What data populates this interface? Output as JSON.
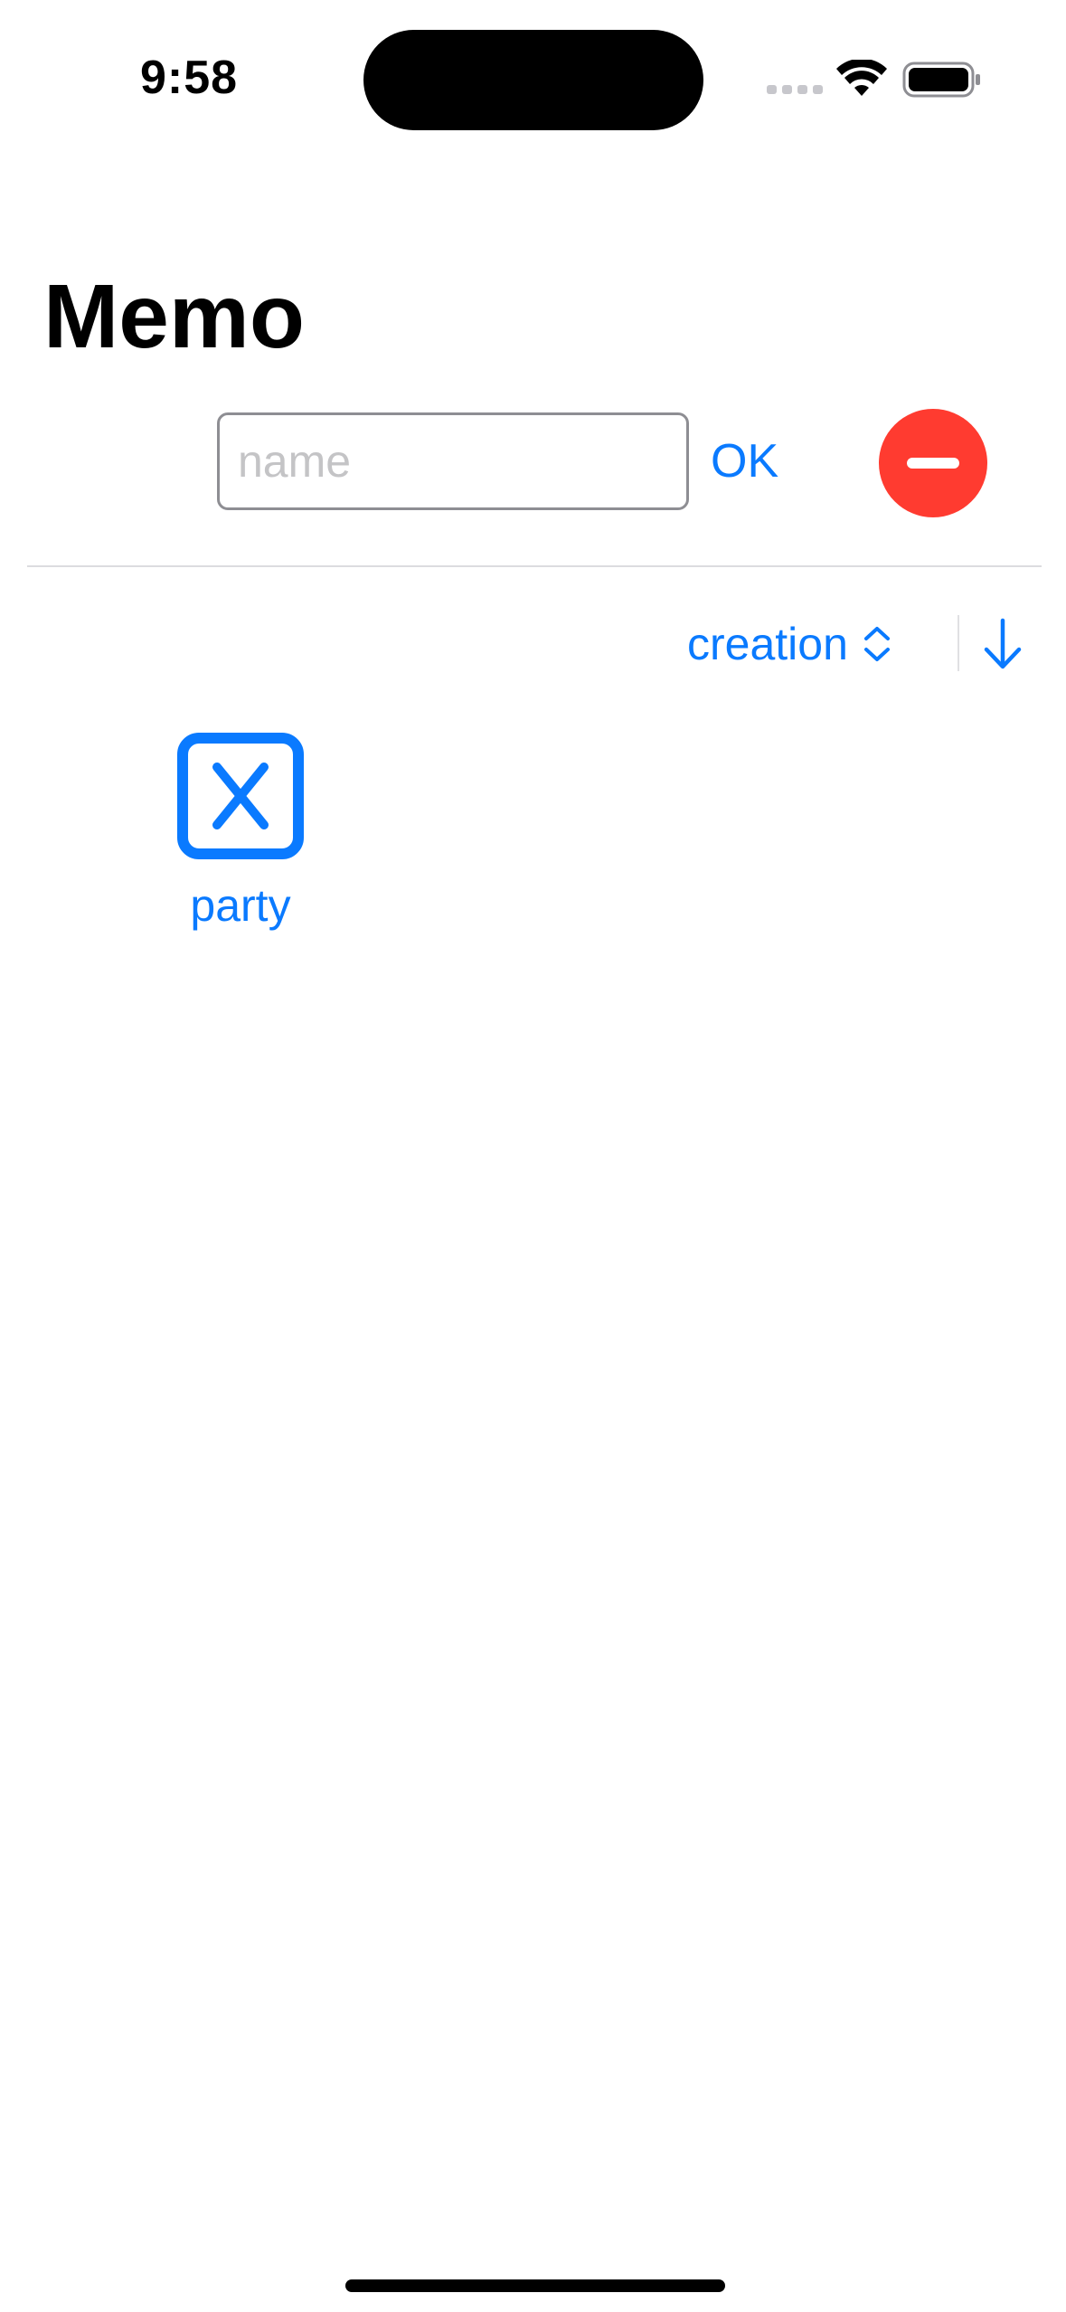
{
  "status_bar": {
    "time": "9:58"
  },
  "header": {
    "title": "Memo"
  },
  "input": {
    "value": "",
    "placeholder": "name"
  },
  "actions": {
    "ok_label": "OK",
    "delete_icon": "minus-circle-icon"
  },
  "sort": {
    "selected": "creation",
    "picker_icon": "chevron-updown-icon",
    "direction_icon": "arrow-down-icon",
    "direction": "descending"
  },
  "memos": [
    {
      "label": "party",
      "icon": "xmark-square-icon"
    }
  ],
  "colors": {
    "accent": "#0a7aff",
    "destructive": "#ff3b30",
    "divider": "#dcdcdf"
  }
}
